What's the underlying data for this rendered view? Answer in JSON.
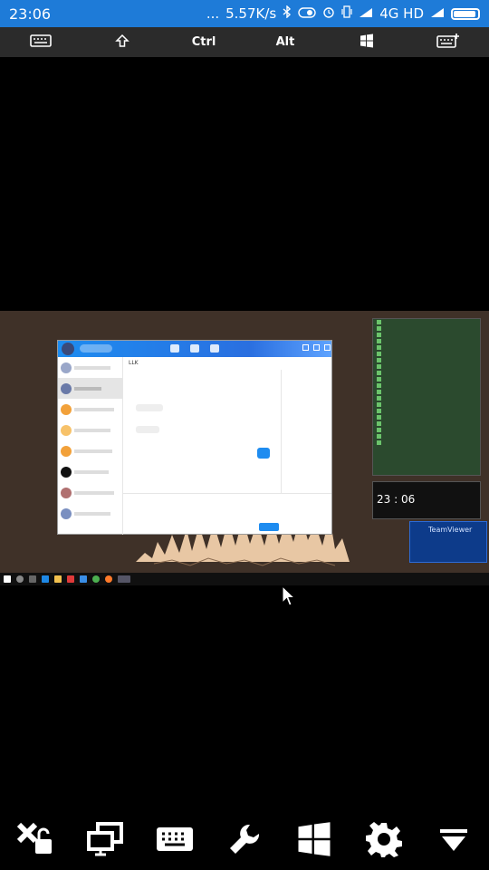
{
  "status_bar": {
    "time": "23:06",
    "dots": "...",
    "speed": "5.57K/s",
    "network": "4G HD",
    "icons": [
      "bluetooth-icon",
      "toggle-icon",
      "alarm-icon",
      "vibrate-icon",
      "signal-icon",
      "signal-icon",
      "battery-icon"
    ]
  },
  "key_bar": {
    "ctrl_label": "Ctrl",
    "alt_label": "Alt",
    "icons": [
      "keyboard-icon",
      "shift-icon",
      "windows-icon",
      "keyboard-add-icon"
    ]
  },
  "remote_screen": {
    "qq_window": {
      "chat_title": "LLK",
      "colors": {
        "header": "#1d8cf0",
        "send_button": "#1e8cf0"
      }
    },
    "clock_widget": {
      "time": "23 : 06"
    },
    "teamviewer": {
      "title": "TeamViewer"
    }
  },
  "bottom_toolbar": {
    "icons": [
      "disconnect-icon",
      "monitors-icon",
      "keyboard-icon",
      "wrench-icon",
      "windows-icon",
      "settings-icon",
      "menu-down-icon"
    ]
  }
}
